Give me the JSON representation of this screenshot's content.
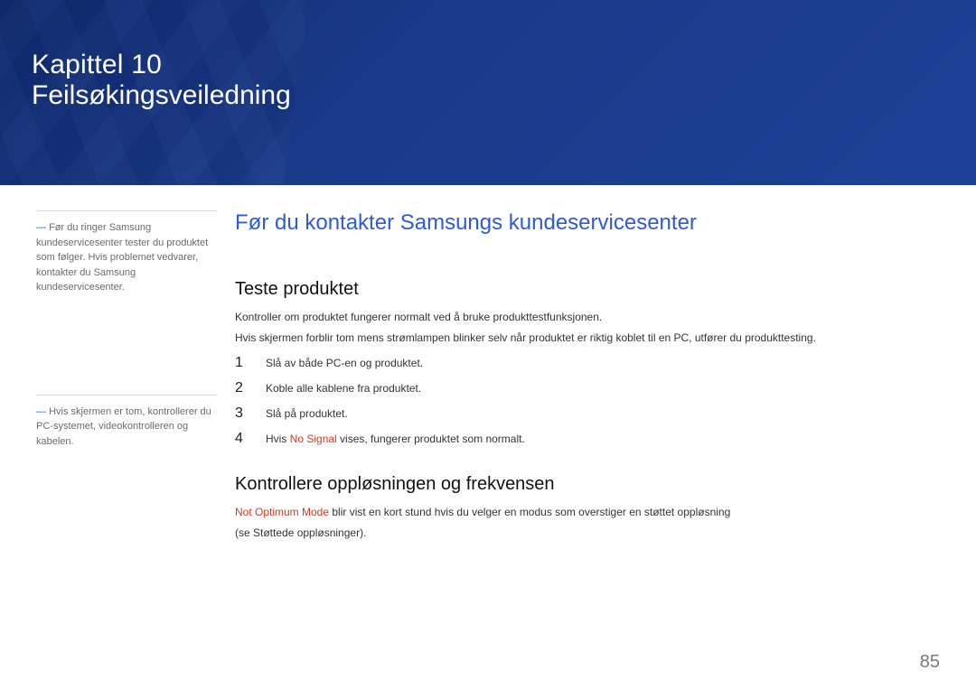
{
  "hero": {
    "chapter": "Kapittel 10",
    "title": "Feilsøkingsveiledning"
  },
  "side": {
    "dash": "―",
    "note1": "Før du ringer Samsung kundeservicesenter tester du produktet som følger. Hvis problemet vedvarer, kontakter du Samsung kundeservicesenter.",
    "note2": "Hvis skjermen er tom, kontrollerer du PC-systemet, videokontrolleren og kabelen."
  },
  "main": {
    "h1": "Før du kontakter Samsungs kundeservicesenter",
    "section1": {
      "h2": "Teste produktet",
      "p1": "Kontroller om produktet fungerer normalt ved å bruke produkttestfunksjonen.",
      "p2": "Hvis skjermen forblir tom mens strømlampen blinker selv når produktet er riktig koblet til en PC, utfører du produkttesting.",
      "steps": [
        {
          "n": "1",
          "text": "Slå av både PC-en og produktet."
        },
        {
          "n": "2",
          "text": "Koble alle kablene fra produktet."
        },
        {
          "n": "3",
          "text": "Slå på produktet."
        },
        {
          "n": "4",
          "pre": "Hvis ",
          "hl": "No Signal",
          "post": " vises, fungerer produktet som normalt."
        }
      ]
    },
    "section2": {
      "h2": "Kontrollere oppløsningen og frekvensen",
      "p_hl": "Not Optimum Mode",
      "p_rest": " blir vist en kort stund hvis du velger en modus som overstiger en støttet oppløsning",
      "p2": "(se Støttede oppløsninger)."
    }
  },
  "page": "85"
}
